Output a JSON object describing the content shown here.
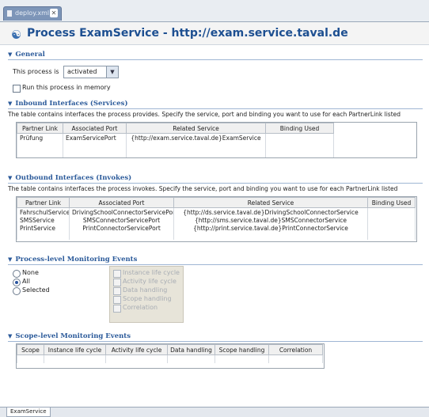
{
  "editor_tab": {
    "label": "deploy.xml",
    "close": "✕"
  },
  "header": {
    "title": "Process ExamService - http://exam.service.taval.de"
  },
  "general": {
    "title": "General",
    "process_label": "This process is",
    "process_value": "activated",
    "memory_label": "Run this process in memory"
  },
  "inbound": {
    "title": "Inbound Interfaces (Services)",
    "description": "The table contains interfaces the process provides.  Specify the service, port and binding you want to use for each PartnerLink listed",
    "columns": [
      "Partner Link",
      "Associated Port",
      "Related Service",
      "Binding Used"
    ],
    "rows": [
      [
        "Prüfung",
        "ExamServicePort",
        "{http://exam.service.taval.de}ExamService",
        ""
      ]
    ]
  },
  "outbound": {
    "title": "Outbound Interfaces (Invokes)",
    "description": "The table contains interfaces the process invokes.  Specify the service, port and binding you want to use for each PartnerLink listed",
    "columns": [
      "Partner Link",
      "Associated Port",
      "Related Service",
      "Binding Used"
    ],
    "rows": [
      [
        "FahrschulService",
        "DrivingSchoolConnectorServicePort",
        "{http://ds.service.taval.de}DrivingSchoolConnectorService",
        ""
      ],
      [
        "SMSService",
        "SMSConnectorServicePort",
        "{http://sms.service.taval.de}SMSConnectorService",
        ""
      ],
      [
        "PrintService",
        "PrintConnectorServicePort",
        "{http://print.service.taval.de}PrintConnectorService",
        ""
      ]
    ]
  },
  "process_monitoring": {
    "title": "Process-level Monitoring Events",
    "radios": [
      "None",
      "All",
      "Selected"
    ],
    "selected": "All",
    "events": [
      "Instance life cycle",
      "Activity life cycle",
      "Data handling",
      "Scope handling",
      "Correlation"
    ]
  },
  "scope_monitoring": {
    "title": "Scope-level Monitoring Events",
    "columns": [
      "Scope",
      "Instance life cycle",
      "Activity life cycle",
      "Data handling",
      "Scope handling",
      "Correlation"
    ]
  },
  "bottom_tab": {
    "label": "ExamService"
  }
}
